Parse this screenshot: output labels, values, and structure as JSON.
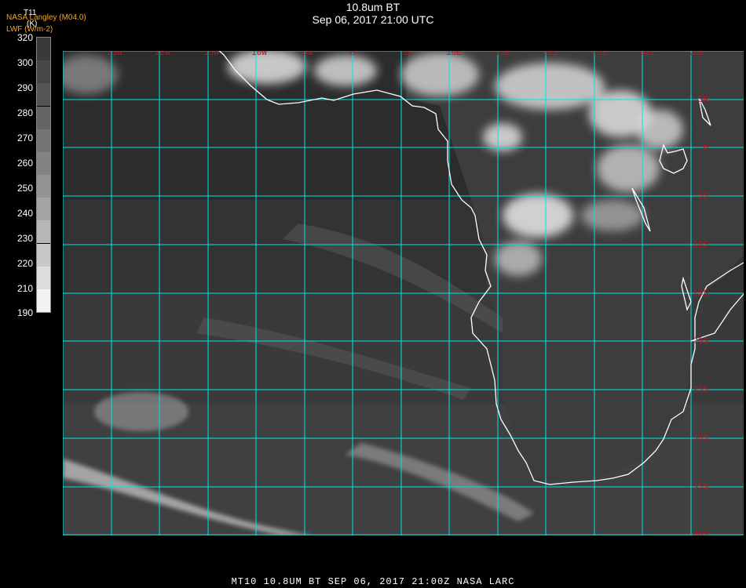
{
  "header": {
    "title": "10.8um BT",
    "datetime": "Sep 06, 2017 21:00 UTC",
    "org_line1": "NASA Langley (M04.0)",
    "org_line2": "LWF (W/m-2)"
  },
  "colorbar": {
    "variable": "T11",
    "unit": "(K)",
    "ticks": [
      "320",
      "300",
      "290",
      "280",
      "270",
      "260",
      "250",
      "240",
      "230",
      "220",
      "210",
      "190"
    ]
  },
  "map": {
    "lon_labels": [
      "25W",
      "20W",
      "15W",
      "10W",
      "5W",
      "0",
      "5E",
      "10E",
      "15E",
      "20E",
      "25E",
      "30E",
      "35E"
    ],
    "lat_labels": [
      "5N",
      "0",
      "5S",
      "10S",
      "15S",
      "20S",
      "25S",
      "30S",
      "35S",
      "40S"
    ],
    "grid_color": "#00e5e5",
    "coast_color": "#ffffff",
    "label_color": "#c1121f"
  },
  "footer": {
    "text": "MT10   10.8UM BT    SEP 06, 2017 21:00Z    NASA LARC"
  }
}
